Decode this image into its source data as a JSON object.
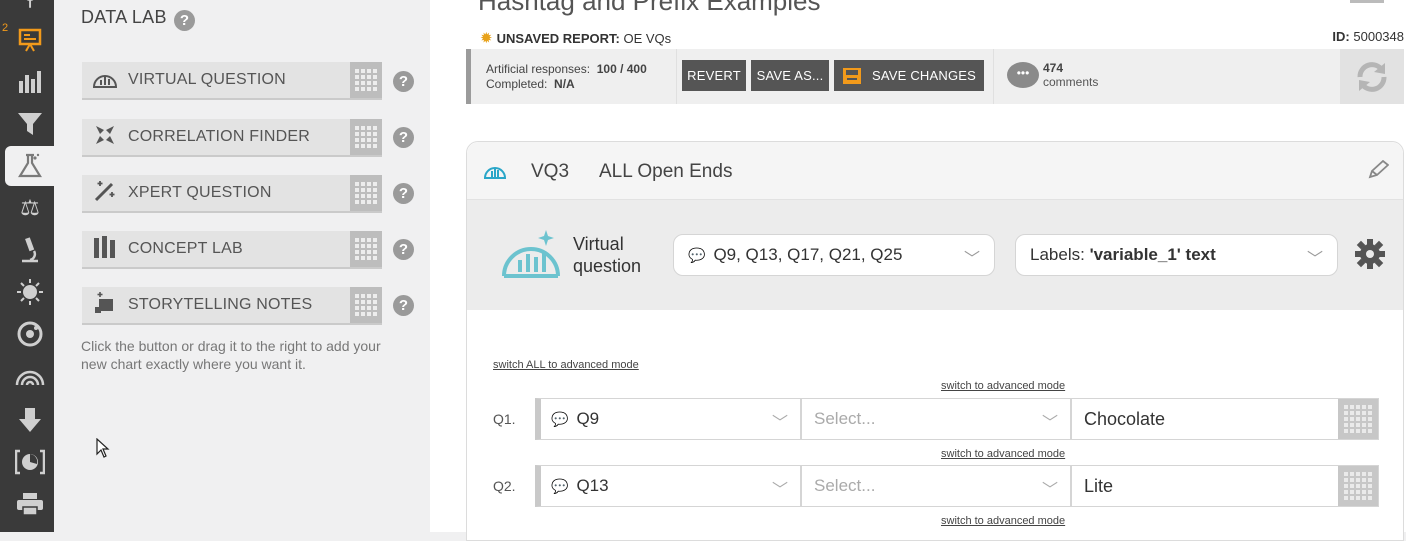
{
  "rail": {
    "badge": "2",
    "items": [
      {
        "name": "rail-pin-icon",
        "glyph": "⚲"
      },
      {
        "name": "rail-presentation-icon",
        "glyph": "▣"
      },
      {
        "name": "rail-bar-chart-icon",
        "glyph": "▮"
      },
      {
        "name": "rail-filter-icon",
        "glyph": "▼"
      },
      {
        "name": "rail-flask-icon",
        "glyph": "⚗"
      },
      {
        "name": "rail-scales-icon",
        "glyph": "⚖"
      },
      {
        "name": "rail-microscope-icon",
        "glyph": "⚕"
      },
      {
        "name": "rail-sun-icon",
        "glyph": "✹"
      },
      {
        "name": "rail-atom-icon",
        "glyph": "⚛"
      },
      {
        "name": "rail-rainbow-icon",
        "glyph": "◠"
      },
      {
        "name": "rail-download-icon",
        "glyph": "⬇"
      },
      {
        "name": "rail-snapshot-icon",
        "glyph": "◔"
      },
      {
        "name": "rail-print-icon",
        "glyph": "⎙"
      }
    ]
  },
  "lab": {
    "title": "DATA LAB",
    "help": "?",
    "buttons": [
      {
        "label": "VIRTUAL QUESTION"
      },
      {
        "label": "CORRELATION FINDER"
      },
      {
        "label": "XPERT QUESTION"
      },
      {
        "label": "CONCEPT LAB"
      },
      {
        "label": "STORYTELLING NOTES"
      }
    ],
    "hint": "Click the button or drag it to the right to add your new chart exactly where you want it."
  },
  "report": {
    "title": "Hashtag and Prefix Examples",
    "unsaved_label": "UNSAVED REPORT:",
    "unsaved_name": "OE VQs",
    "id_label": "ID:",
    "id_value": "5000348"
  },
  "toolbar": {
    "artificial_label": "Artificial responses:",
    "artificial_value": "100 / 400",
    "completed_label": "Completed:",
    "completed_value": "N/A",
    "revert": "REVERT",
    "save_as": "SAVE AS...",
    "save_changes": "SAVE CHANGES",
    "comments_count": "474",
    "comments_label": "comments"
  },
  "card": {
    "code": "VQ3",
    "name": "ALL Open Ends",
    "vq_label_1": "Virtual",
    "vq_label_2": "question",
    "questions_dropdown": "Q9, Q13, Q17, Q21, Q25",
    "labels_prefix": "Labels:",
    "labels_value": "'variable_1' text",
    "switch_all": "switch ALL to advanced mode",
    "switch_one": "switch to advanced mode",
    "rows": [
      {
        "label": "Q1.",
        "question": "Q9",
        "select": "Select...",
        "value": "Chocolate"
      },
      {
        "label": "Q2.",
        "question": "Q13",
        "select": "Select...",
        "value": "Lite"
      }
    ]
  },
  "colors": {
    "accent_orange": "#f29a1b",
    "vq_teal": "#2aa6c8",
    "button_dark": "#555555"
  }
}
